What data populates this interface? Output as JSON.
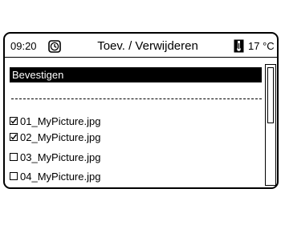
{
  "header": {
    "time": "09:20",
    "title": "Toev. / Verwijderen",
    "temperature": "17 °C"
  },
  "icons": {
    "clock": "clock-icon",
    "thermometer": "thermometer-icon"
  },
  "confirm_label": "Bevestigen",
  "files": [
    {
      "name": "01_MyPicture.jpg",
      "checked": true
    },
    {
      "name": "02_MyPicture.jpg",
      "checked": true
    },
    {
      "name": "03_MyPicture.jpg",
      "checked": false
    },
    {
      "name": "04_MyPicture.jpg",
      "checked": false
    }
  ],
  "colors": {
    "selected_bg": "#000000",
    "selected_text": "#ffffff"
  }
}
